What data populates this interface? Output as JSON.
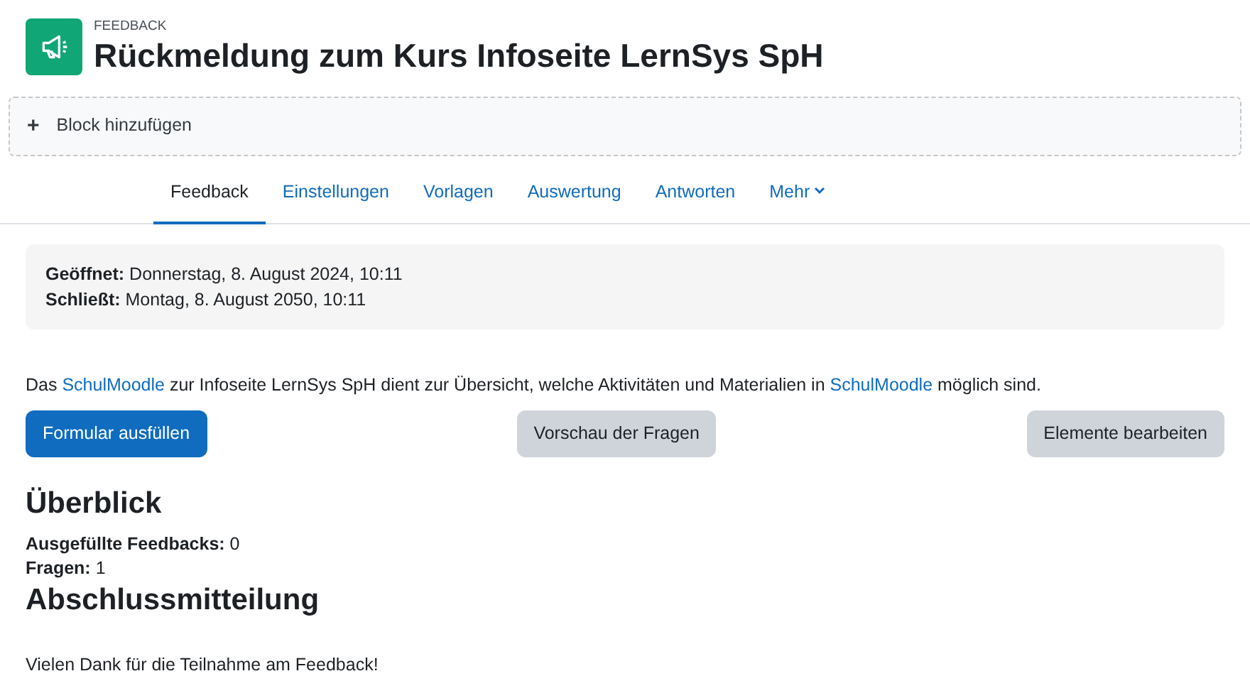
{
  "header": {
    "category": "FEEDBACK",
    "title": "Rückmeldung zum Kurs Infoseite LernSys SpH"
  },
  "add_block": {
    "icon": "+",
    "label": "Block hinzufügen"
  },
  "tabs": [
    {
      "label": "Feedback",
      "selected": true,
      "kind": "tab"
    },
    {
      "label": "Einstellungen",
      "selected": false,
      "kind": "tab"
    },
    {
      "label": "Vorlagen",
      "selected": false,
      "kind": "tab"
    },
    {
      "label": "Auswertung",
      "selected": false,
      "kind": "tab"
    },
    {
      "label": "Antworten",
      "selected": false,
      "kind": "tab"
    },
    {
      "label": "Mehr",
      "selected": false,
      "kind": "dropdown"
    }
  ],
  "dates": [
    "**Geöffnet:** Donnerstag, 8. August 2024, 10:11",
    "**Schließt:** Montag, 8. August 2050, 10:11"
  ],
  "description": [
    {
      "kind": "text",
      "text": "Das "
    },
    {
      "kind": "link",
      "text": "SchulMoodle"
    },
    {
      "kind": "text",
      "text": " zur Infoseite LernSys SpH dient zur Übersicht, welche Aktivitäten und Materialien in "
    },
    {
      "kind": "link",
      "text": "SchulMoodle"
    },
    {
      "kind": "text",
      "text": " möglich sind."
    }
  ],
  "buttons": [
    {
      "label": "Formular ausfüllen",
      "kind": "primary"
    },
    {
      "label": "Vorschau der Fragen",
      "kind": "secondary"
    },
    {
      "label": "Elemente bearbeiten",
      "kind": "secondary"
    }
  ],
  "overview": {
    "title": "Überblick",
    "stats": [
      "**Ausgefüllte Feedbacks:** 0",
      "**Fragen:** 1"
    ]
  },
  "completion": {
    "title": "Abschlussmitteilung",
    "message": "Vielen Dank für die Teilnahme am Feedback!"
  }
}
